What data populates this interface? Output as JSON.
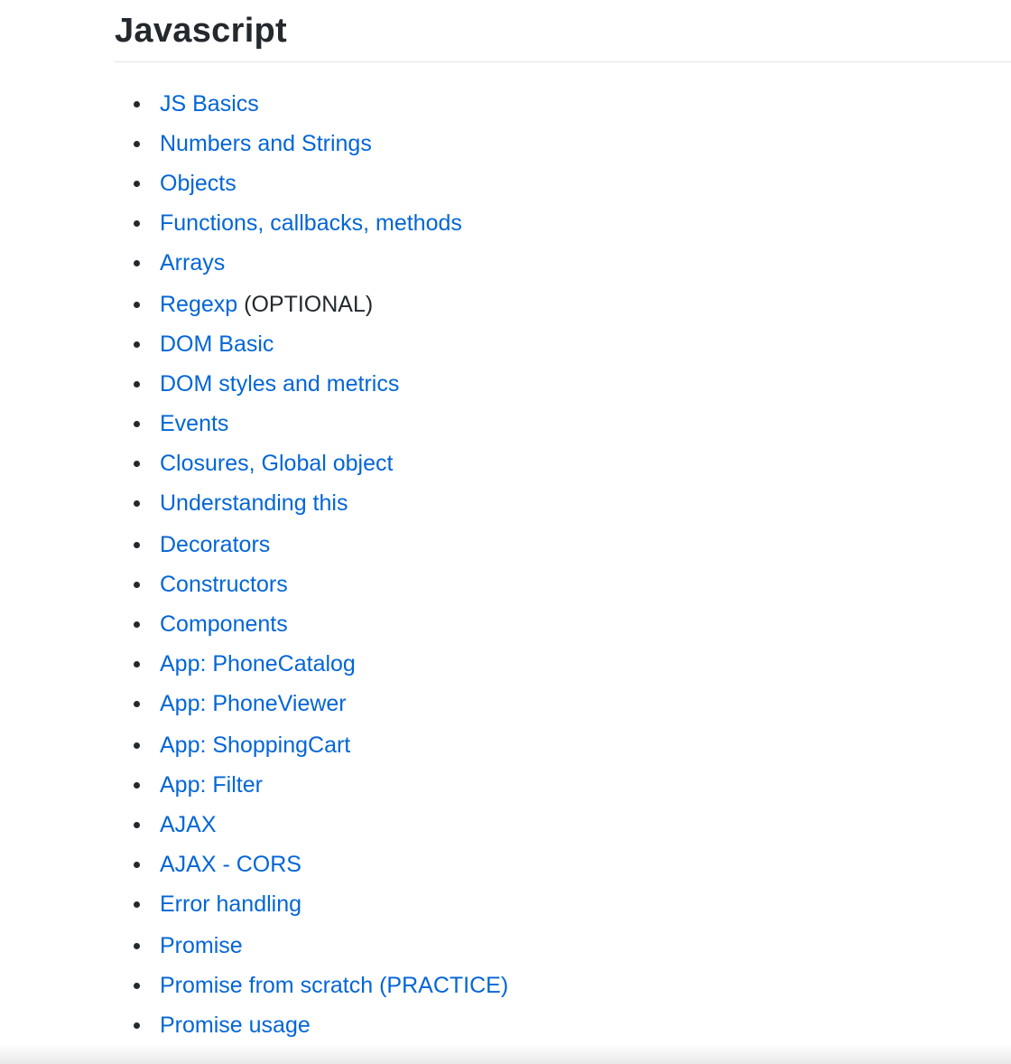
{
  "section": {
    "title": "Javascript"
  },
  "colors": {
    "link": "#0366d6",
    "text": "#24292e",
    "divider": "#e1e4e8"
  },
  "topics": [
    {
      "label": "JS Basics",
      "note": ""
    },
    {
      "label": "Numbers and Strings",
      "note": ""
    },
    {
      "label": "Objects",
      "note": ""
    },
    {
      "label": "Functions, callbacks, methods",
      "note": ""
    },
    {
      "label": "Arrays",
      "note": ""
    },
    {
      "label": "Regexp",
      "note": " (OPTIONAL)"
    },
    {
      "label": "DOM Basic",
      "note": ""
    },
    {
      "label": "DOM styles and metrics",
      "note": ""
    },
    {
      "label": "Events",
      "note": ""
    },
    {
      "label": "Closures, Global object",
      "note": ""
    },
    {
      "label": "Understanding this",
      "note": ""
    },
    {
      "label": "Decorators",
      "note": ""
    },
    {
      "label": "Constructors",
      "note": ""
    },
    {
      "label": "Components",
      "note": ""
    },
    {
      "label": "App: PhoneCatalog",
      "note": ""
    },
    {
      "label": "App: PhoneViewer",
      "note": ""
    },
    {
      "label": "App: ShoppingCart",
      "note": ""
    },
    {
      "label": "App: Filter",
      "note": ""
    },
    {
      "label": "AJAX",
      "note": ""
    },
    {
      "label": "AJAX - CORS",
      "note": ""
    },
    {
      "label": "Error handling",
      "note": ""
    },
    {
      "label": "Promise",
      "note": ""
    },
    {
      "label": "Promise from scratch (PRACTICE)",
      "note": ""
    },
    {
      "label": "Promise usage",
      "note": ""
    }
  ]
}
